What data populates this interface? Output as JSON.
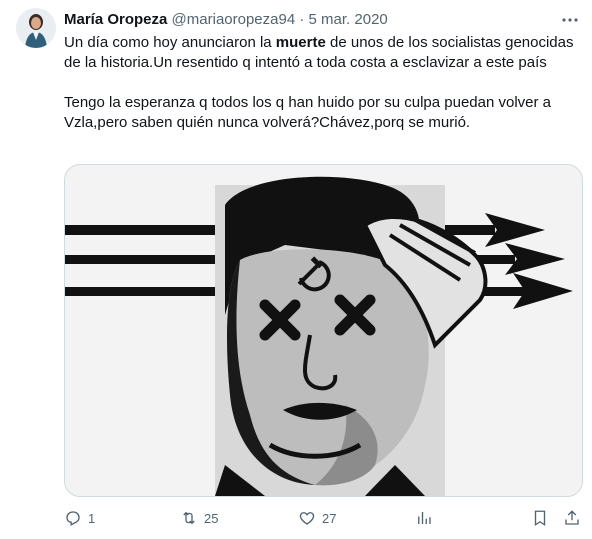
{
  "tweet": {
    "author": {
      "display_name": "María Oropeza",
      "handle": "@mariaoropeza94",
      "separator": "·",
      "date": "5 mar. 2020"
    },
    "text_before_bold": "Un día como hoy anunciaron la ",
    "text_bold": "muerte",
    "text_after_bold": " de unos de los socialistas genocidas de la historia.Un resentido q intentó a toda costa a esclavizar a este país\n\nTengo la esperanza q todos los q han huido por su culpa puedan volver a Vzla,pero saben quién nunca volverá?Chávez,porq se murió.",
    "actions": {
      "replies": "1",
      "retweets": "25",
      "likes": "27"
    },
    "icons": {
      "more": "more-icon",
      "reply": "reply-icon",
      "retweet": "retweet-icon",
      "like": "like-icon",
      "views": "views-icon",
      "bookmark": "bookmark-icon",
      "share": "share-icon"
    },
    "colors": {
      "text": "#0f1419",
      "secondary": "#536471",
      "border": "#cfd9de"
    }
  }
}
